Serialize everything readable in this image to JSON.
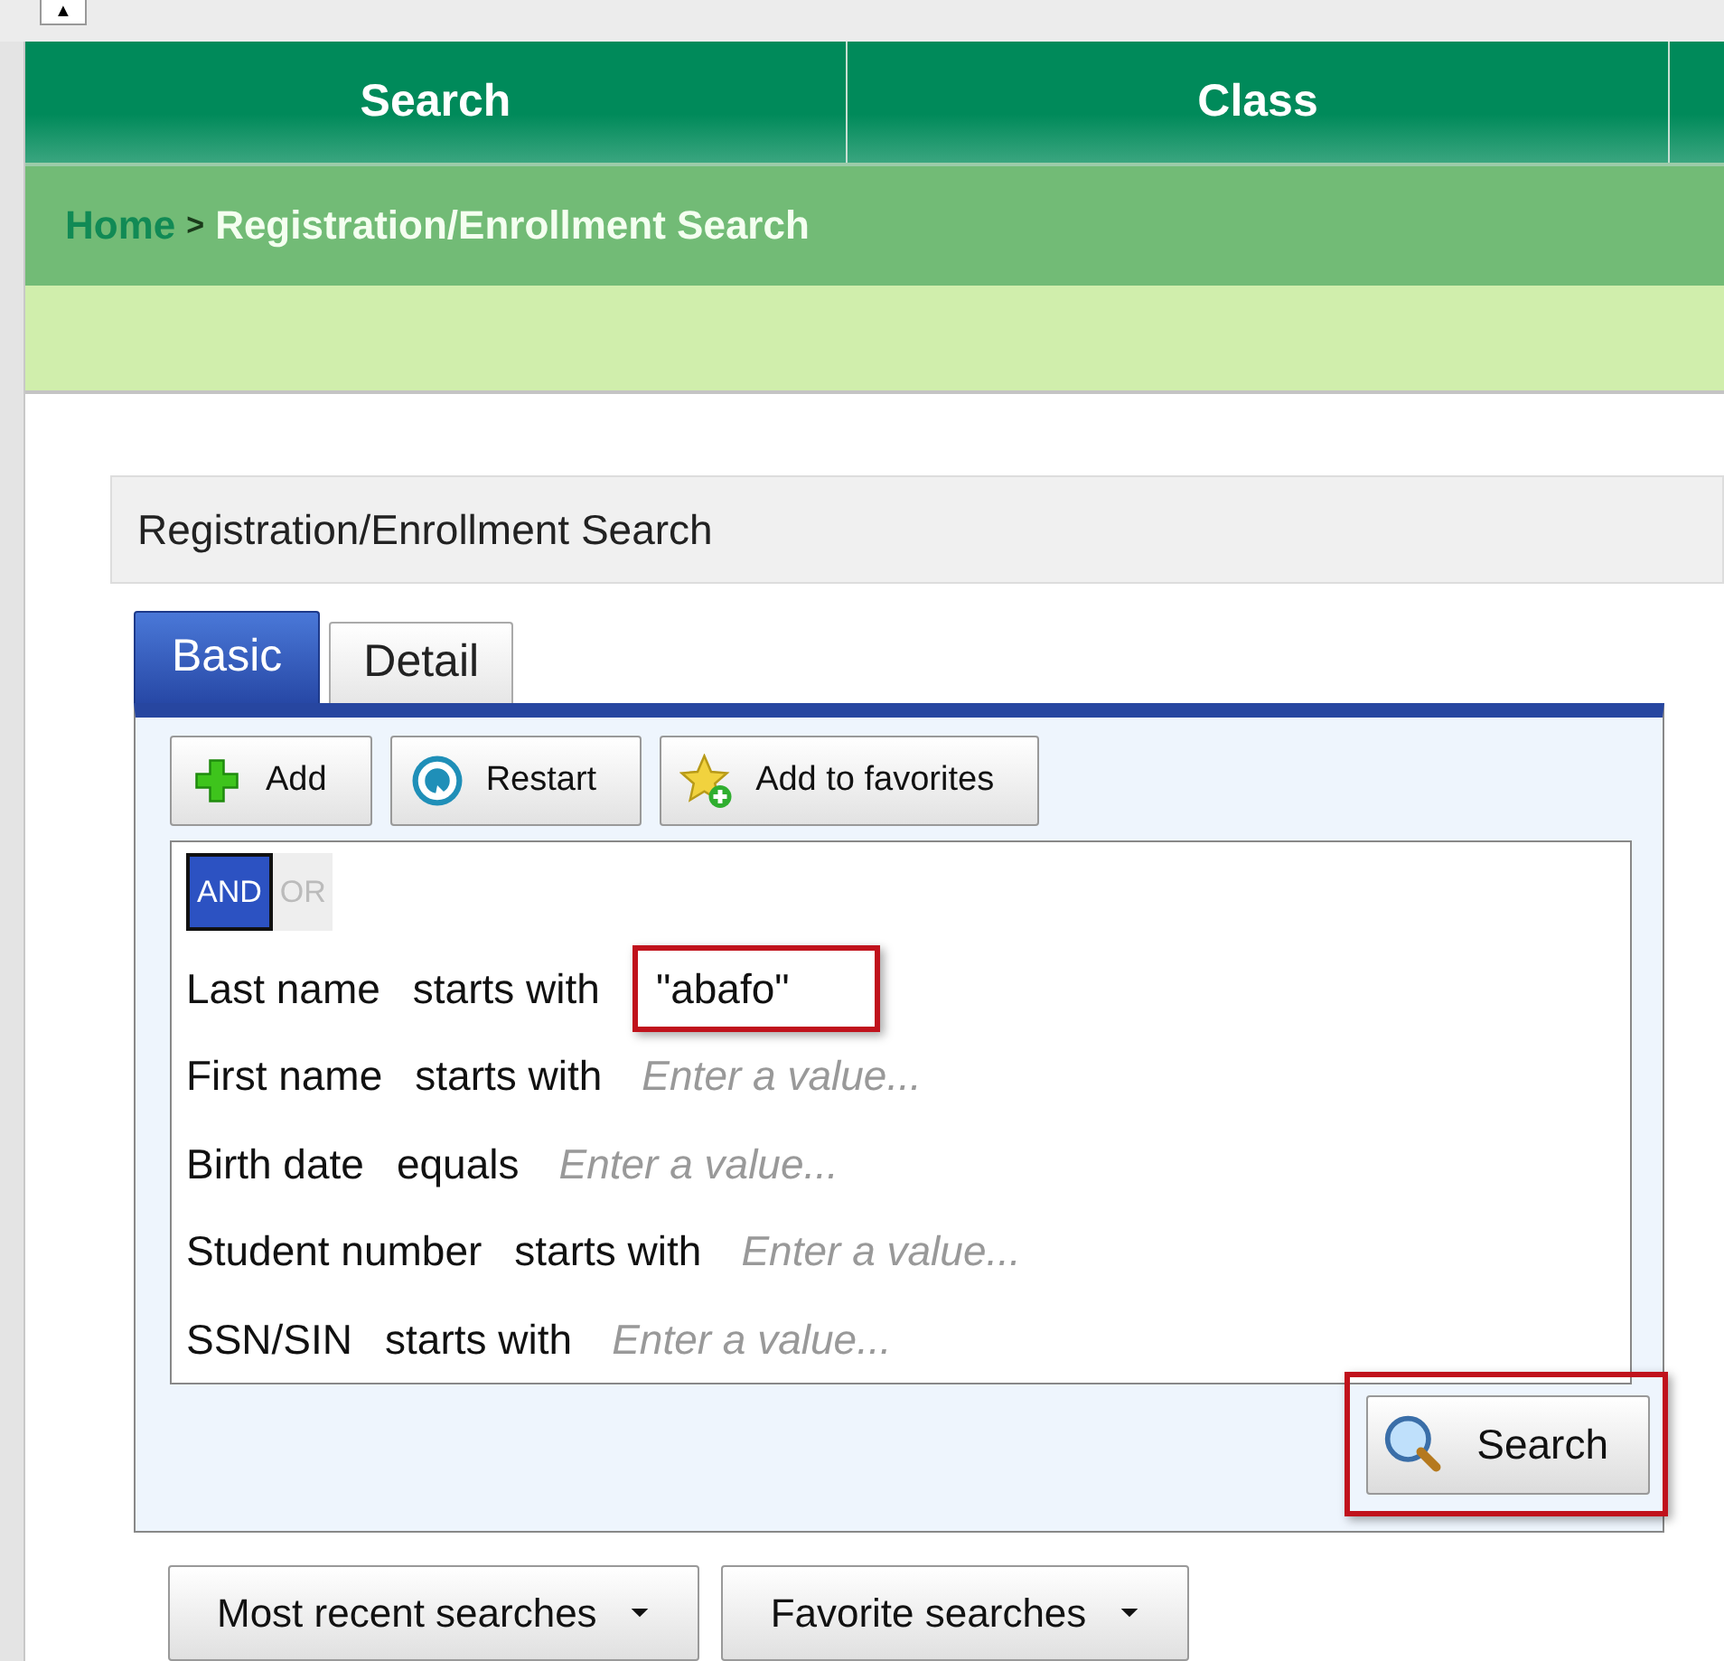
{
  "collapse_button": {
    "label": "▲"
  },
  "nav_tabs": [
    {
      "label": "Search"
    },
    {
      "label": "Class"
    }
  ],
  "breadcrumb": {
    "home": "Home",
    "separator": ">",
    "current": "Registration/Enrollment Search"
  },
  "panel": {
    "title": "Registration/Enrollment Search",
    "tabs": [
      {
        "label": "Basic",
        "selected": true
      },
      {
        "label": "Detail",
        "selected": false
      }
    ],
    "toolbar": [
      {
        "kind": "add",
        "label": "Add"
      },
      {
        "kind": "restart",
        "label": "Restart"
      },
      {
        "kind": "favorite",
        "label": "Add to favorites"
      }
    ],
    "logic": [
      {
        "label": "AND",
        "selected": true
      },
      {
        "label": "OR",
        "selected": false
      }
    ],
    "criteria": [
      {
        "field": "Last name",
        "operator": "starts with",
        "value": "\"abafo\"",
        "highlighted": true
      },
      {
        "field": "First name",
        "operator": "starts with",
        "placeholder": "Enter a value...",
        "highlighted": false
      },
      {
        "field": "Birth date",
        "operator": "equals",
        "placeholder": "Enter a value...",
        "highlighted": false
      },
      {
        "field": "Student number",
        "operator": "starts with",
        "placeholder": "Enter a value...",
        "highlighted": false
      },
      {
        "field": "SSN/SIN",
        "operator": "starts with",
        "placeholder": "Enter a value...",
        "highlighted": false
      }
    ],
    "search_button": {
      "label": "Search",
      "highlighted": true
    }
  },
  "dropdowns": [
    {
      "label": "Most recent searches"
    },
    {
      "label": "Favorite searches"
    }
  ]
}
